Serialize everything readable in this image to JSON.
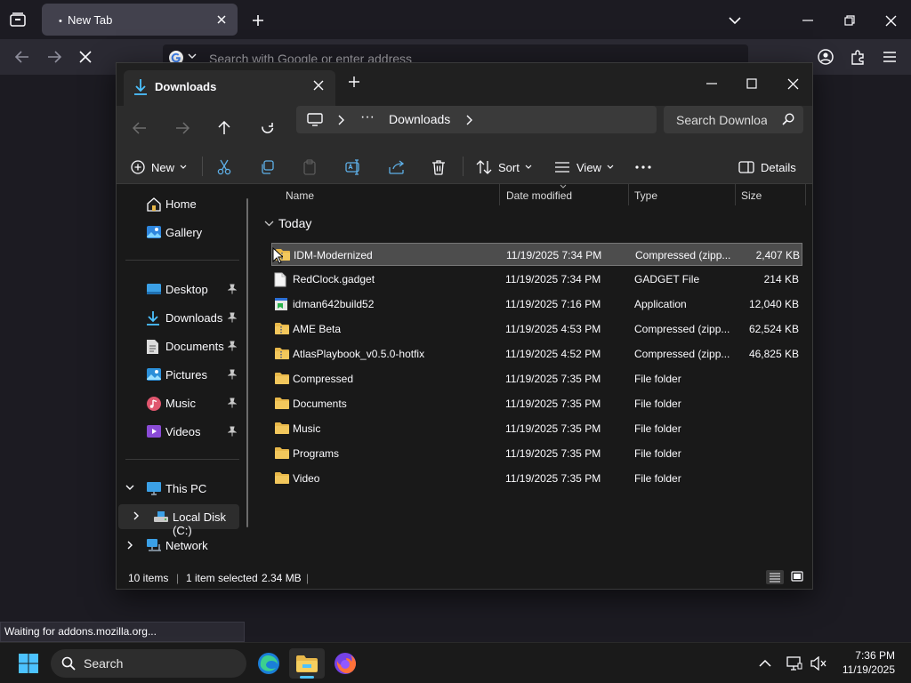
{
  "browser": {
    "tab_title": "New Tab",
    "url_placeholder": "Search with Google or enter address",
    "status_text": "Waiting for addons.mozilla.org..."
  },
  "explorer": {
    "tab_title": "Downloads",
    "path": {
      "ellipsis": "···",
      "current": "Downloads"
    },
    "search_placeholder": "Search Downloads",
    "commands": {
      "new": "New",
      "sort": "Sort",
      "view": "View",
      "details": "Details"
    },
    "nav": {
      "top": [
        {
          "label": "Home",
          "icon": "home-icon"
        },
        {
          "label": "Gallery",
          "icon": "gallery-icon"
        }
      ],
      "pinned": [
        {
          "label": "Desktop",
          "icon": "desktop-icon"
        },
        {
          "label": "Downloads",
          "icon": "downloads-icon"
        },
        {
          "label": "Documents",
          "icon": "documents-icon"
        },
        {
          "label": "Pictures",
          "icon": "pictures-icon"
        },
        {
          "label": "Music",
          "icon": "music-icon"
        },
        {
          "label": "Videos",
          "icon": "videos-icon"
        }
      ],
      "this_pc": "This PC",
      "local_disk": "Local Disk (C:)",
      "network": "Network"
    },
    "columns": {
      "name": "Name",
      "date": "Date modified",
      "type": "Type",
      "size": "Size"
    },
    "group": "Today",
    "files": [
      {
        "name": "IDM-Modernized",
        "date": "11/19/2025 7:34 PM",
        "type": "Compressed (zipp...",
        "size": "2,407 KB",
        "icon": "zip-folder-icon",
        "selected": true
      },
      {
        "name": "RedClock.gadget",
        "date": "11/19/2025 7:34 PM",
        "type": "GADGET File",
        "size": "214 KB",
        "icon": "file-icon",
        "selected": false
      },
      {
        "name": "idman642build52",
        "date": "11/19/2025 7:16 PM",
        "type": "Application",
        "size": "12,040 KB",
        "icon": "application-icon",
        "selected": false
      },
      {
        "name": "AME Beta",
        "date": "11/19/2025 4:53 PM",
        "type": "Compressed (zipp...",
        "size": "62,524 KB",
        "icon": "zip-folder-icon",
        "selected": false
      },
      {
        "name": "AtlasPlaybook_v0.5.0-hotfix",
        "date": "11/19/2025 4:52 PM",
        "type": "Compressed (zipp...",
        "size": "46,825 KB",
        "icon": "zip-folder-icon",
        "selected": false
      },
      {
        "name": "Compressed",
        "date": "11/19/2025 7:35 PM",
        "type": "File folder",
        "size": "",
        "icon": "folder-icon",
        "selected": false
      },
      {
        "name": "Documents",
        "date": "11/19/2025 7:35 PM",
        "type": "File folder",
        "size": "",
        "icon": "folder-icon",
        "selected": false
      },
      {
        "name": "Music",
        "date": "11/19/2025 7:35 PM",
        "type": "File folder",
        "size": "",
        "icon": "folder-icon",
        "selected": false
      },
      {
        "name": "Programs",
        "date": "11/19/2025 7:35 PM",
        "type": "File folder",
        "size": "",
        "icon": "folder-icon",
        "selected": false
      },
      {
        "name": "Video",
        "date": "11/19/2025 7:35 PM",
        "type": "File folder",
        "size": "",
        "icon": "folder-icon",
        "selected": false
      }
    ],
    "status": {
      "items": "10 items",
      "selected": "1 item selected",
      "size": "2.34 MB"
    }
  },
  "taskbar": {
    "search_label": "Search",
    "time": "7:36 PM",
    "date": "11/19/2025"
  },
  "colors": {
    "folder": "#e8b84a",
    "accent": "#4cc2ff",
    "selection": "#4d4d4d"
  }
}
